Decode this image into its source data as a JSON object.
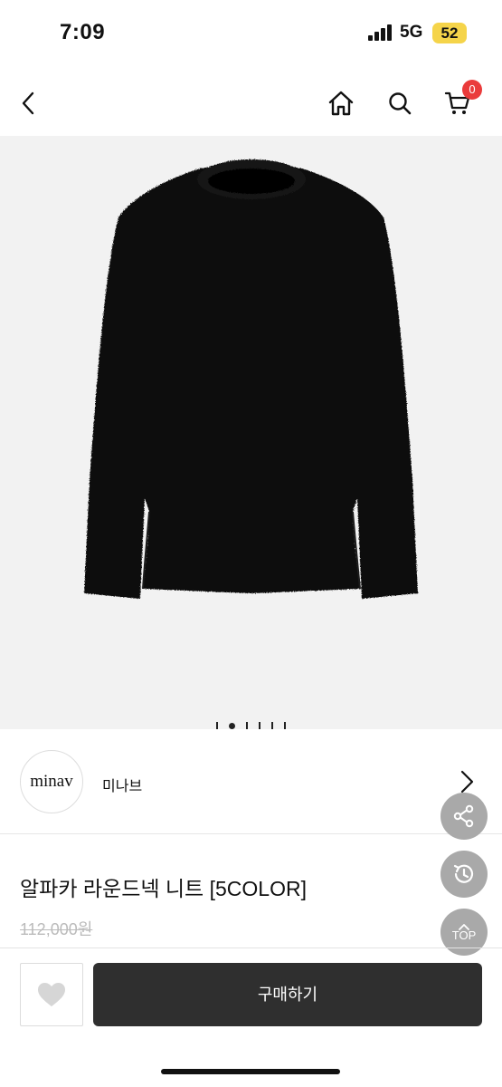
{
  "status": {
    "time": "7:09",
    "network": "5G",
    "battery": "52"
  },
  "header": {
    "cart_count": "0"
  },
  "gallery": {
    "slide_count": 6,
    "active_index": 1
  },
  "brand": {
    "logo_text": "minav",
    "name": "미나브"
  },
  "product": {
    "title": "알파카 라운드넥 니트 [5COLOR]",
    "original_price": "112,000원"
  },
  "floating": {
    "top_label": "TOP"
  },
  "actions": {
    "buy_label": "구매하기"
  },
  "colors": {
    "buy_button": "#2f2f2f",
    "badge": "#ea3b3b",
    "floating": "#a9a9a9",
    "image_bg": "#f2f2f2",
    "battery": "#f5d44a"
  },
  "icons": [
    "back-arrow-icon",
    "home-icon",
    "search-icon",
    "cart-icon",
    "chevron-right-icon",
    "share-icon",
    "history-icon",
    "chevron-up-icon",
    "heart-icon"
  ]
}
